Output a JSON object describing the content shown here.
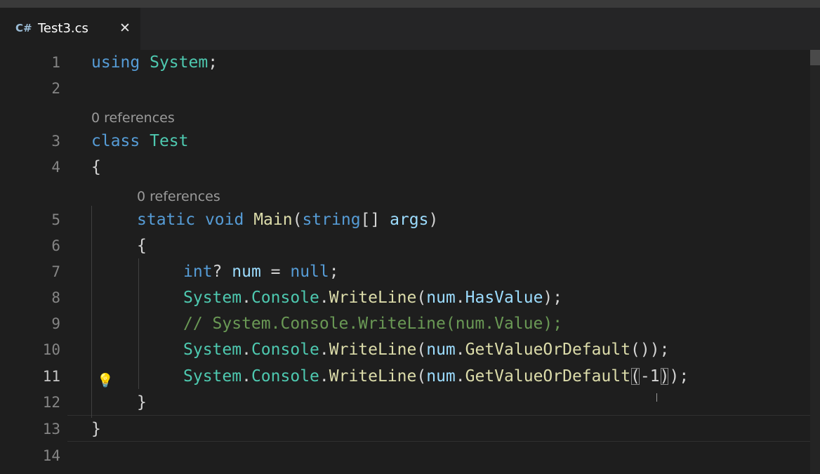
{
  "tab": {
    "icon": "C#",
    "filename": "Test3.cs",
    "close_icon": "✕"
  },
  "codelens": {
    "class_refs": "0 references",
    "method_refs": "0 references"
  },
  "line_numbers": [
    "1",
    "2",
    "3",
    "4",
    "5",
    "6",
    "7",
    "8",
    "9",
    "10",
    "11",
    "12",
    "13",
    "14"
  ],
  "code": {
    "l1": {
      "kw": "using",
      "type": "System",
      "punct": ";"
    },
    "l3": {
      "kw": "class",
      "name": "Test"
    },
    "l4": {
      "brace": "{"
    },
    "l5": {
      "static": "static",
      "void": "void",
      "name": "Main",
      "open": "(",
      "type": "string",
      "brackets": "[]",
      "param": "args",
      "close": ")"
    },
    "l6": {
      "brace": "{"
    },
    "l7": {
      "type": "int",
      "q": "?",
      "var": "num",
      "eq": " = ",
      "null": "null",
      "semi": ";"
    },
    "l8": {
      "system": "System",
      "dot1": ".",
      "console": "Console",
      "dot2": ".",
      "method": "WriteLine",
      "open": "(",
      "var": "num",
      "dot3": ".",
      "prop": "HasValue",
      "close": ");"
    },
    "l9": {
      "comment": "// System.Console.WriteLine(num.Value);"
    },
    "l10": {
      "system": "System",
      "dot1": ".",
      "console": "Console",
      "dot2": ".",
      "method": "WriteLine",
      "open": "(",
      "var": "num",
      "dot3": ".",
      "method2": "GetValueOrDefault",
      "args": "()",
      "close": ");"
    },
    "l11": {
      "system": "System",
      "dot1": ".",
      "console": "Console",
      "dot2": ".",
      "method": "WriteLine",
      "open": "(",
      "var": "num",
      "dot3": ".",
      "method2": "GetValueOrDefault",
      "paren_open": "(",
      "arg": "-1",
      "paren_close": ")",
      "close": ");"
    },
    "l12": {
      "brace": "}"
    },
    "l13": {
      "brace": "}"
    }
  },
  "lightbulb_icon": "💡"
}
